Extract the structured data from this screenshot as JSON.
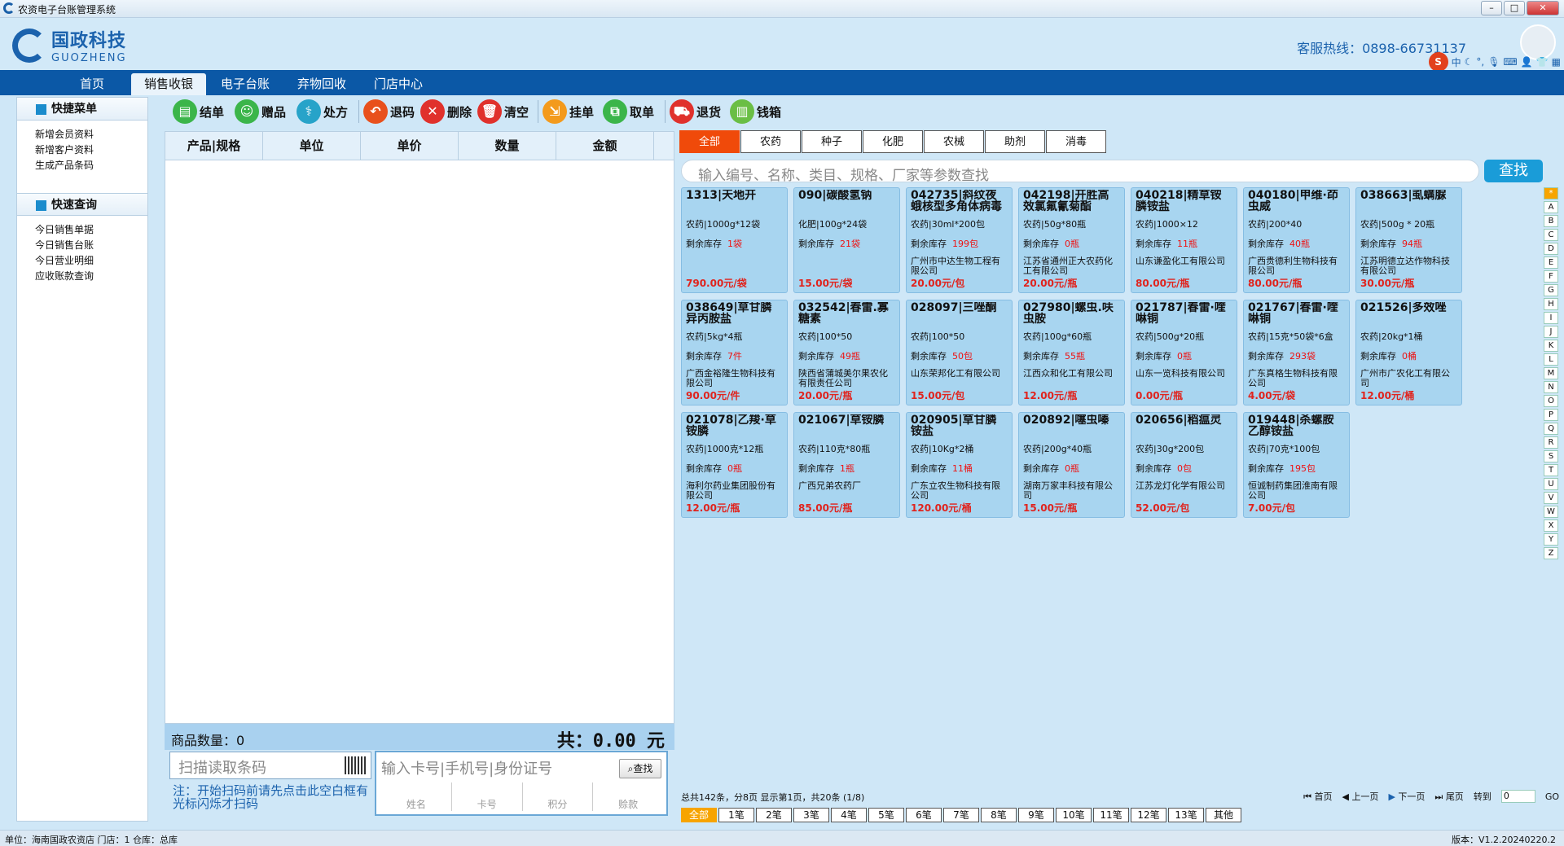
{
  "window": {
    "title": "农资电子台账管理系统"
  },
  "brand": {
    "name_cn": "国政科技",
    "name_en": "GUOZHENG",
    "hotline": "客服热线：0898-66731137"
  },
  "ime": {
    "logo": "S",
    "mode": "中"
  },
  "nav": {
    "tabs": [
      "首页",
      "销售收银",
      "电子台账",
      "弃物回收",
      "门店中心"
    ],
    "active": 1
  },
  "sidebar": {
    "quick_menu": {
      "title": "快捷菜单",
      "items": [
        "新增会员资料",
        "新增客户资料",
        "生成产品条码"
      ]
    },
    "quick_query": {
      "title": "快速查询",
      "items": [
        "今日销售单据",
        "今日销售台账",
        "今日营业明细",
        "应收账款查询"
      ]
    }
  },
  "toolbar": {
    "settle": "结单",
    "gift": "赠品",
    "prescription": "处方",
    "return_code": "退码",
    "delete": "删除",
    "clear": "清空",
    "hold": "挂单",
    "retrieve": "取单",
    "refund": "退货",
    "cashbox": "钱箱"
  },
  "cart": {
    "columns": [
      "产品|规格",
      "单位",
      "单价",
      "数量",
      "金额"
    ],
    "count_label": "商品数量：0",
    "total_label": "共：0.00 元"
  },
  "scan": {
    "placeholder": "扫描读取条码",
    "hint": "注：开始扫码前请先点击此空白框有光标闪烁才扫码"
  },
  "member": {
    "placeholder": "输入卡号|手机号|身份证号",
    "find": "查找",
    "cols": [
      "姓名",
      "卡号",
      "积分",
      "赊款"
    ]
  },
  "categories": [
    "全部",
    "农药",
    "种子",
    "化肥",
    "农械",
    "助剂",
    "消毒"
  ],
  "search": {
    "placeholder": "输入编号、名称、类目、规格、厂家等参数查找",
    "button": "查找"
  },
  "products": [
    {
      "name": "1313|天地开",
      "spec": "农药|1000g*12袋",
      "stock_label": "剩余库存",
      "stock": "1袋",
      "maker": "",
      "price": "790.00元/袋"
    },
    {
      "name": "090|碳酸氢钠",
      "spec": "化肥|100g*24袋",
      "stock_label": "剩余库存",
      "stock": "21袋",
      "maker": "",
      "price": "15.00元/袋"
    },
    {
      "name": "042735|斜纹夜蛾核型多角体病毒",
      "spec": "农药|30ml*200包",
      "stock_label": "剩余库存",
      "stock": "199包",
      "maker": "广州市中达生物工程有限公司",
      "price": "20.00元/包"
    },
    {
      "name": "042198|开胜高效氯氟氰菊酯",
      "spec": "农药|50g*80瓶",
      "stock_label": "剩余库存",
      "stock": "0瓶",
      "maker": "江苏省通州正大农药化工有限公司",
      "price": "20.00元/瓶"
    },
    {
      "name": "040218|精草铵膦铵盐",
      "spec": "农药|1000×12",
      "stock_label": "剩余库存",
      "stock": "11瓶",
      "maker": "山东谦盈化工有限公司",
      "price": "80.00元/瓶"
    },
    {
      "name": "040180|甲维·茚虫威",
      "spec": "农药|200*40",
      "stock_label": "剩余库存",
      "stock": "40瓶",
      "maker": "广西贵德利生物科技有限公司",
      "price": "80.00元/瓶"
    },
    {
      "name": "038663|虱螨脲",
      "spec": "农药|500g * 20瓶",
      "stock_label": "剩余库存",
      "stock": "94瓶",
      "maker": "江苏明德立达作物科技有限公司",
      "price": "30.00元/瓶"
    },
    {
      "name": "038649|草甘膦异丙胺盐",
      "spec": "农药|5kg*4瓶",
      "stock_label": "剩余库存",
      "stock": "7件",
      "maker": "广西金裕隆生物科技有限公司",
      "price": "90.00元/件"
    },
    {
      "name": "032542|春雷.寡糖素",
      "spec": "农药|100*50",
      "stock_label": "剩余库存",
      "stock": "49瓶",
      "maker": "陕西省蒲城美尔果农化有限责任公司",
      "price": "20.00元/瓶"
    },
    {
      "name": "028097|三唑酮",
      "spec": "农药|100*50",
      "stock_label": "剩余库存",
      "stock": "50包",
      "maker": "山东荣邦化工有限公司",
      "price": "15.00元/包"
    },
    {
      "name": "027980|螺虫.呋虫胺",
      "spec": "农药|100g*60瓶",
      "stock_label": "剩余库存",
      "stock": "55瓶",
      "maker": "江西众和化工有限公司",
      "price": "12.00元/瓶"
    },
    {
      "name": "021787|春雷·喹啉铜",
      "spec": "农药|500g*20瓶",
      "stock_label": "剩余库存",
      "stock": "0瓶",
      "maker": "山东一览科技有限公司",
      "price": "0.00元/瓶"
    },
    {
      "name": "021767|春雷·喹啉铜",
      "spec": "农药|15克*50袋*6盒",
      "stock_label": "剩余库存",
      "stock": "293袋",
      "maker": "广东真格生物科技有限公司",
      "price": "4.00元/袋"
    },
    {
      "name": "021526|多效唑",
      "spec": "农药|20kg*1桶",
      "stock_label": "剩余库存",
      "stock": "0桶",
      "maker": "广州市广农化工有限公司",
      "price": "12.00元/桶"
    },
    {
      "name": "021078|乙羧·草铵膦",
      "spec": "农药|1000克*12瓶",
      "stock_label": "剩余库存",
      "stock": "0瓶",
      "maker": "海利尔药业集团股份有限公司",
      "price": "12.00元/瓶"
    },
    {
      "name": "021067|草铵膦",
      "spec": "农药|110克*80瓶",
      "stock_label": "剩余库存",
      "stock": "1瓶",
      "maker": "广西兄弟农药厂",
      "price": "85.00元/瓶"
    },
    {
      "name": "020905|草甘膦铵盐",
      "spec": "农药|10Kg*2桶",
      "stock_label": "剩余库存",
      "stock": "11桶",
      "maker": "广东立农生物科技有限公司",
      "price": "120.00元/桶"
    },
    {
      "name": "020892|噻虫嗪",
      "spec": "农药|200g*40瓶",
      "stock_label": "剩余库存",
      "stock": "0瓶",
      "maker": "湖南万家丰科技有限公司",
      "price": "15.00元/瓶"
    },
    {
      "name": "020656|稻瘟灵",
      "spec": "农药|30g*200包",
      "stock_label": "剩余库存",
      "stock": "0包",
      "maker": "江苏龙灯化学有限公司",
      "price": "52.00元/包"
    },
    {
      "name": "019448|杀螺胺乙醇铵盐",
      "spec": "农药|70克*100包",
      "stock_label": "剩余库存",
      "stock": "195包",
      "maker": "恒诚制药集团淮南有限公司",
      "price": "7.00元/包"
    }
  ],
  "alphabet": [
    "*",
    "A",
    "B",
    "C",
    "D",
    "E",
    "F",
    "G",
    "H",
    "I",
    "J",
    "K",
    "L",
    "M",
    "N",
    "O",
    "P",
    "Q",
    "R",
    "S",
    "T",
    "U",
    "V",
    "W",
    "X",
    "Y",
    "Z"
  ],
  "pager": {
    "summary": "总共142条，分8页  显示第1页，共20条  (1/8)",
    "first": "首页",
    "prev": "上一页",
    "next": "下一页",
    "last": "尾页",
    "goto": "转到",
    "goto_value": "0",
    "go": "GO"
  },
  "count_filters": [
    "全部",
    "1笔",
    "2笔",
    "3笔",
    "4笔",
    "5笔",
    "6笔",
    "7笔",
    "8笔",
    "9笔",
    "10笔",
    "11笔",
    "12笔",
    "13笔",
    "其他"
  ],
  "status": {
    "left": "单位：海南国政农资店    门店：1    仓库：总库",
    "version": "版本：V1.2.20240220.2"
  },
  "colors": {
    "nav": "#0b58a6",
    "accent": "#f04a0a",
    "card": "#a8d5f0",
    "price": "#e0231d"
  }
}
